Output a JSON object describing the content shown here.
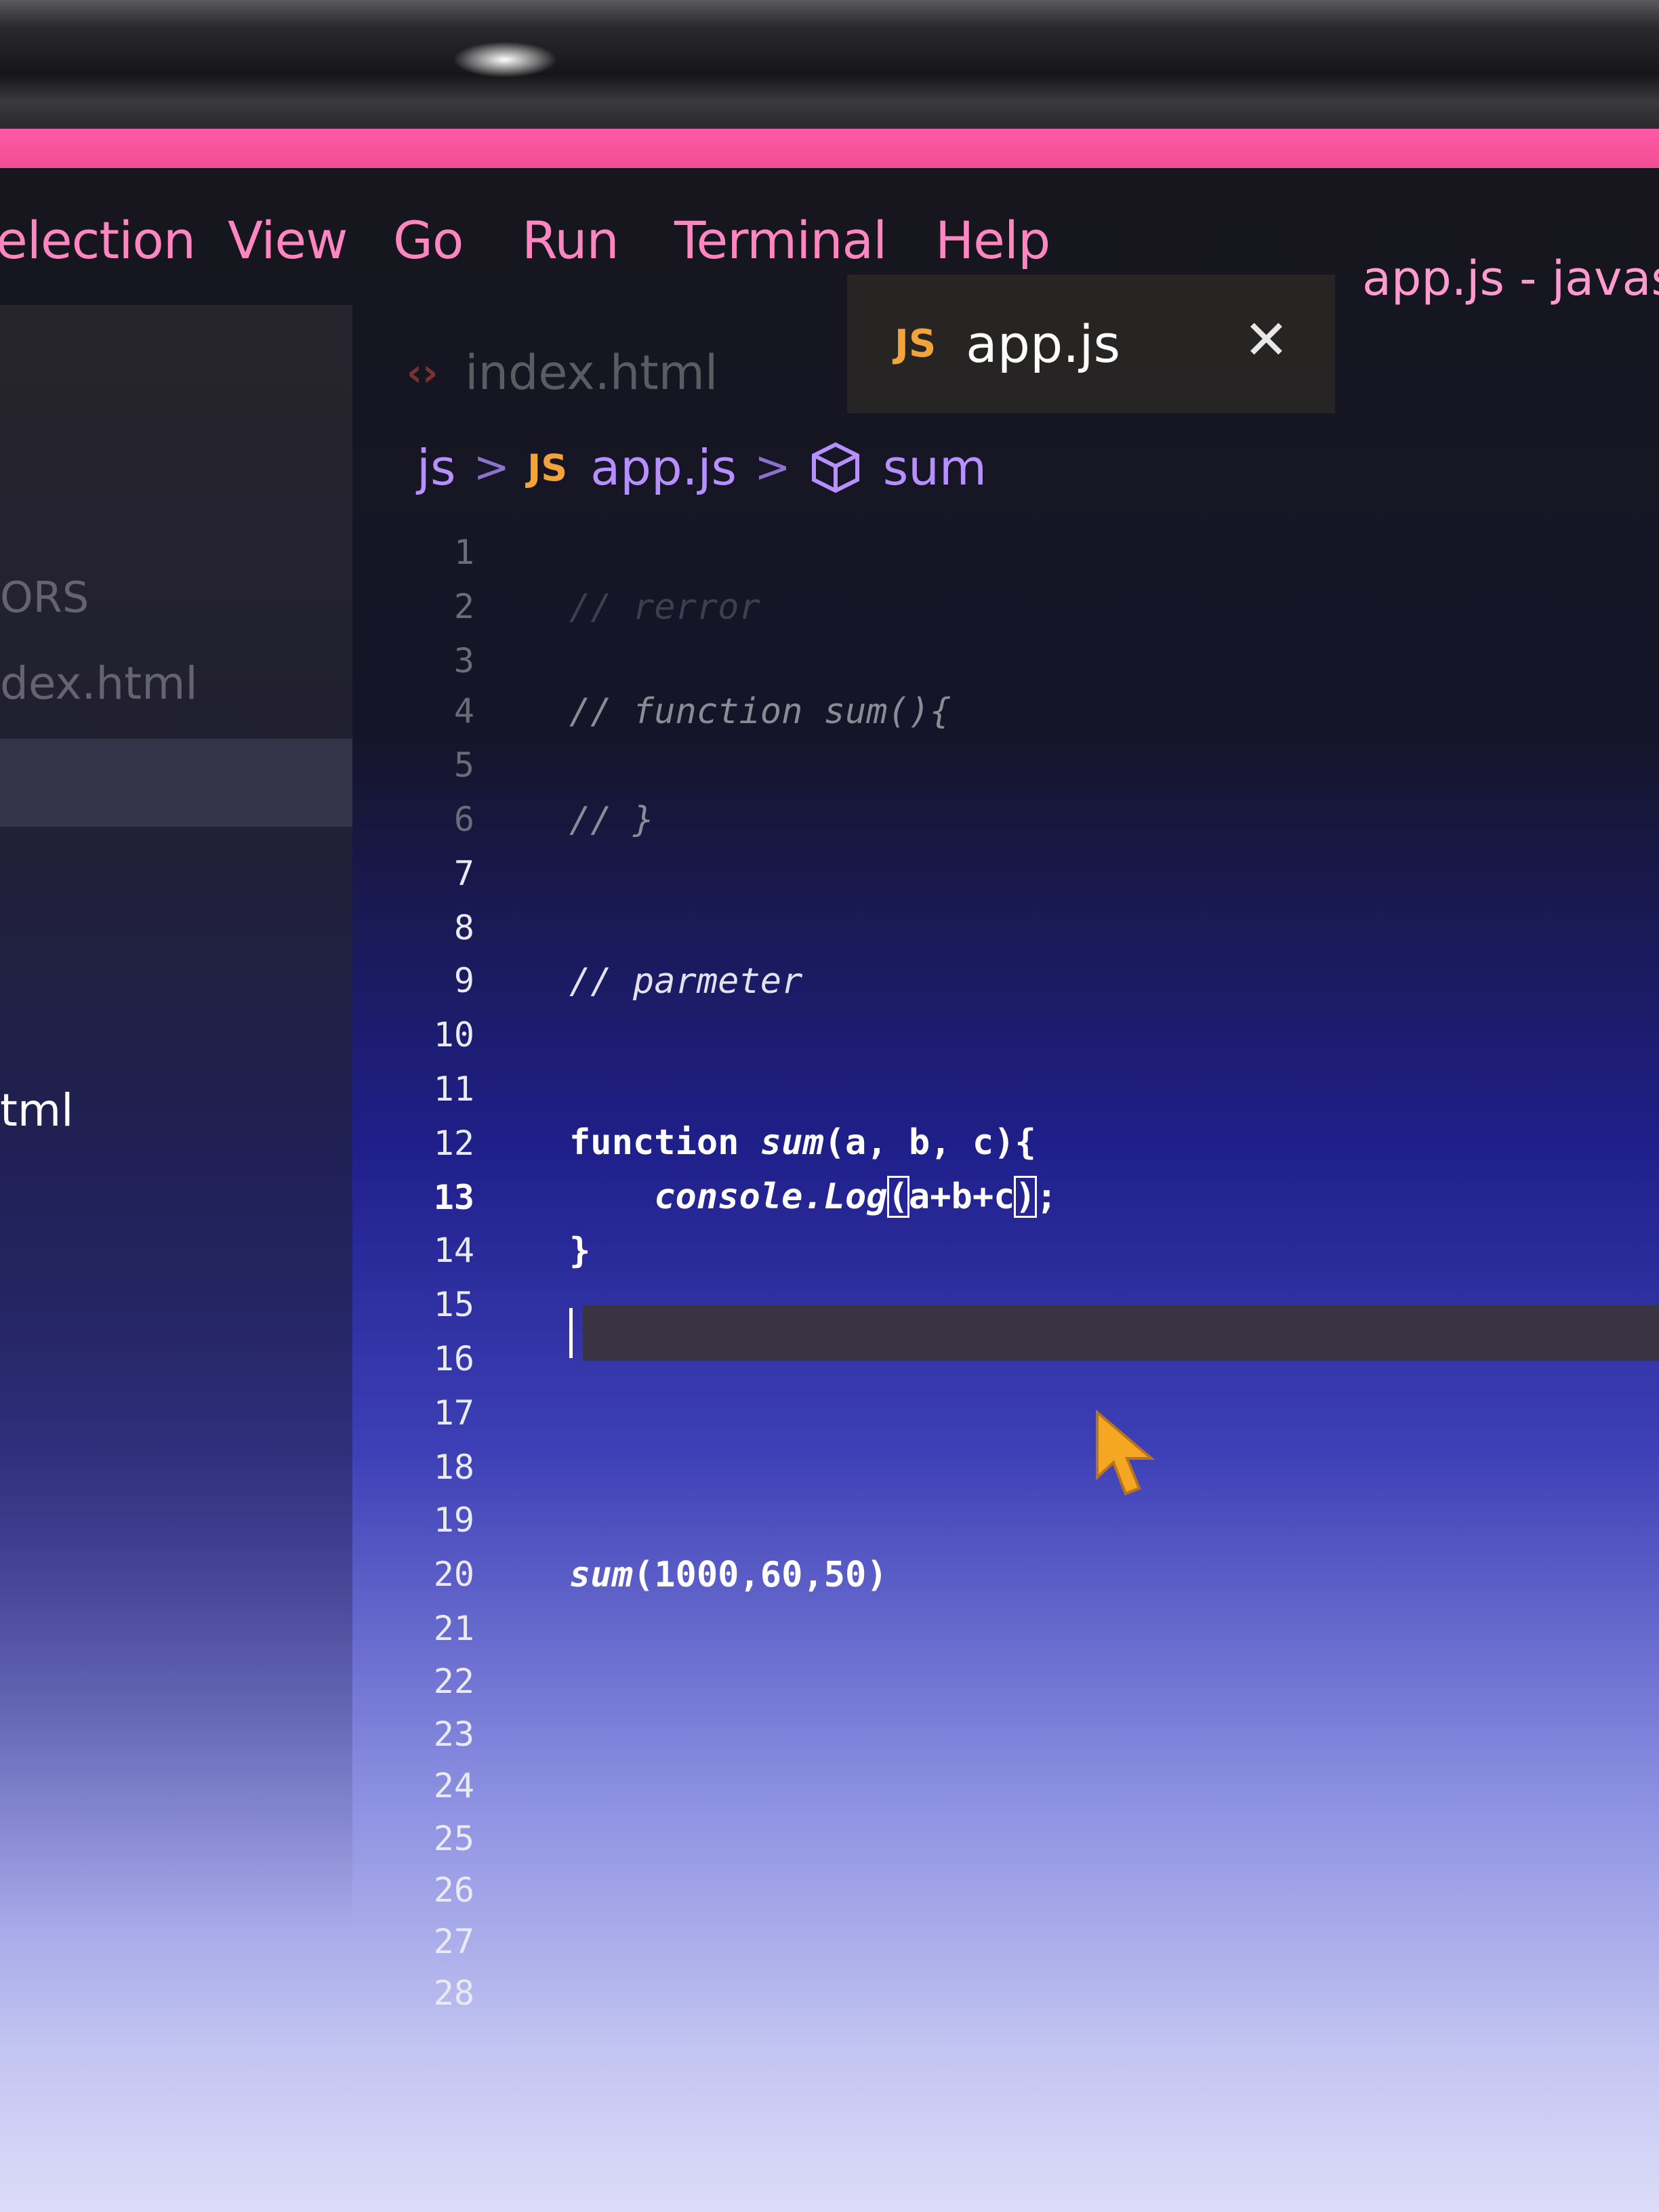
{
  "menu": {
    "items": [
      "election",
      "View",
      "Go",
      "Run",
      "Terminal",
      "Help"
    ],
    "window_title": "app.js - javas"
  },
  "sidebar": {
    "section_label": "ORS",
    "open_editor_item": "dex.html",
    "file_item": "tml"
  },
  "tabs": [
    {
      "icon": "html-icon",
      "label": "index.html",
      "active": false
    },
    {
      "icon": "js-icon",
      "badge": "JS",
      "label": "app.js",
      "active": true
    }
  ],
  "breadcrumb": {
    "folder": "js",
    "file_badge": "JS",
    "file": "app.js",
    "symbol": "sum"
  },
  "editor": {
    "current_line": 13,
    "line_numbers": [
      "1",
      "2",
      "3",
      "4",
      "5",
      "6",
      "7",
      "8",
      "9",
      "10",
      "11",
      "12",
      "13",
      "14",
      "15",
      "16",
      "17",
      "18",
      "19",
      "20",
      "21",
      "22",
      "23",
      "24",
      "25",
      "26",
      "27",
      "28"
    ],
    "code": {
      "line2": "// rerror",
      "line4": "// function sum(){",
      "line6": "// }",
      "line9": "// parmeter",
      "line12_kw": "function",
      "line12_fn": "sum",
      "line12_rest": "(a, b, c){",
      "line13_obj": "    console.",
      "line13_fn": "Log",
      "line13_open": "(",
      "line13_args": "a+b+c",
      "line13_close": ")",
      "line13_end": ";",
      "line14": "}",
      "line19_fn": "sum",
      "line19_rest": "(1000,60,50)"
    }
  },
  "colors": {
    "accent_pink": "#ff5aa6",
    "menu_text": "#ff86c0",
    "breadcrumb": "#b690ff",
    "js_badge": "#f2a43a",
    "html_icon": "#f05a3a",
    "mouse_pointer": "#f5a623"
  }
}
